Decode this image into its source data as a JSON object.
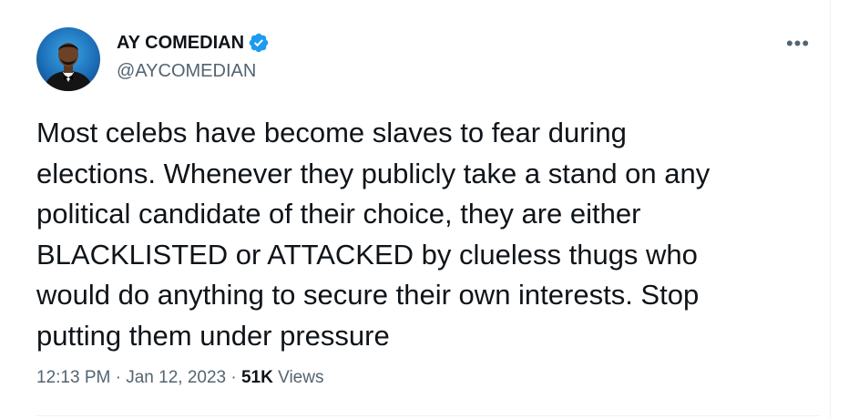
{
  "author": {
    "display_name": "AY COMEDIAN",
    "handle": "@AYCOMEDIAN",
    "verified": true,
    "avatar_icon": "profile-photo"
  },
  "tweet": {
    "text": "Most celebs have become slaves to fear during\nelections. Whenever they publicly take a stand on any\npolitical candidate of their choice, they are either\nBLACKLISTED or ATTACKED by clueless thugs who\nwould do anything to secure their own interests. Stop\nputting them under pressure",
    "time": "12:13 PM",
    "separator": "·",
    "date": "Jan 12, 2023",
    "views_count": "51K",
    "views_label": "Views"
  },
  "menu": {
    "more_icon": "more-horizontal-icon",
    "more_glyph": "•••"
  },
  "colors": {
    "text_primary": "#0f1419",
    "text_secondary": "#536471",
    "verified_blue": "#1d9bf0",
    "divider": "#eff3f4"
  }
}
